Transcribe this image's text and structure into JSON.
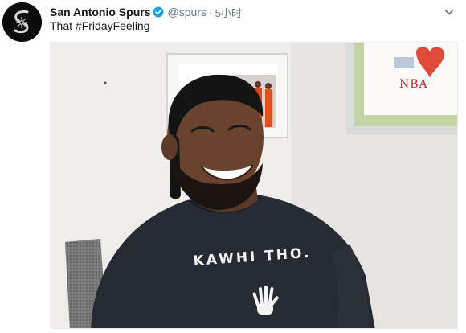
{
  "account": {
    "name": "San Antonio Spurs",
    "handle": "@spurs",
    "separator": "·",
    "time": "5小时",
    "verified": true,
    "avatar_icon": "spurs-logo-icon"
  },
  "tweet": {
    "text": "That #FridayFeeling"
  },
  "media": {
    "shirt_text": "KAWHI THO.",
    "drawing_text": "NBA"
  },
  "icons": {
    "verified": "verified-badge-icon",
    "menu": "chevron-down-icon"
  },
  "colors": {
    "verified_blue": "#1da1f2",
    "muted_text": "#657786",
    "avatar_bg": "#0b0b0b"
  }
}
